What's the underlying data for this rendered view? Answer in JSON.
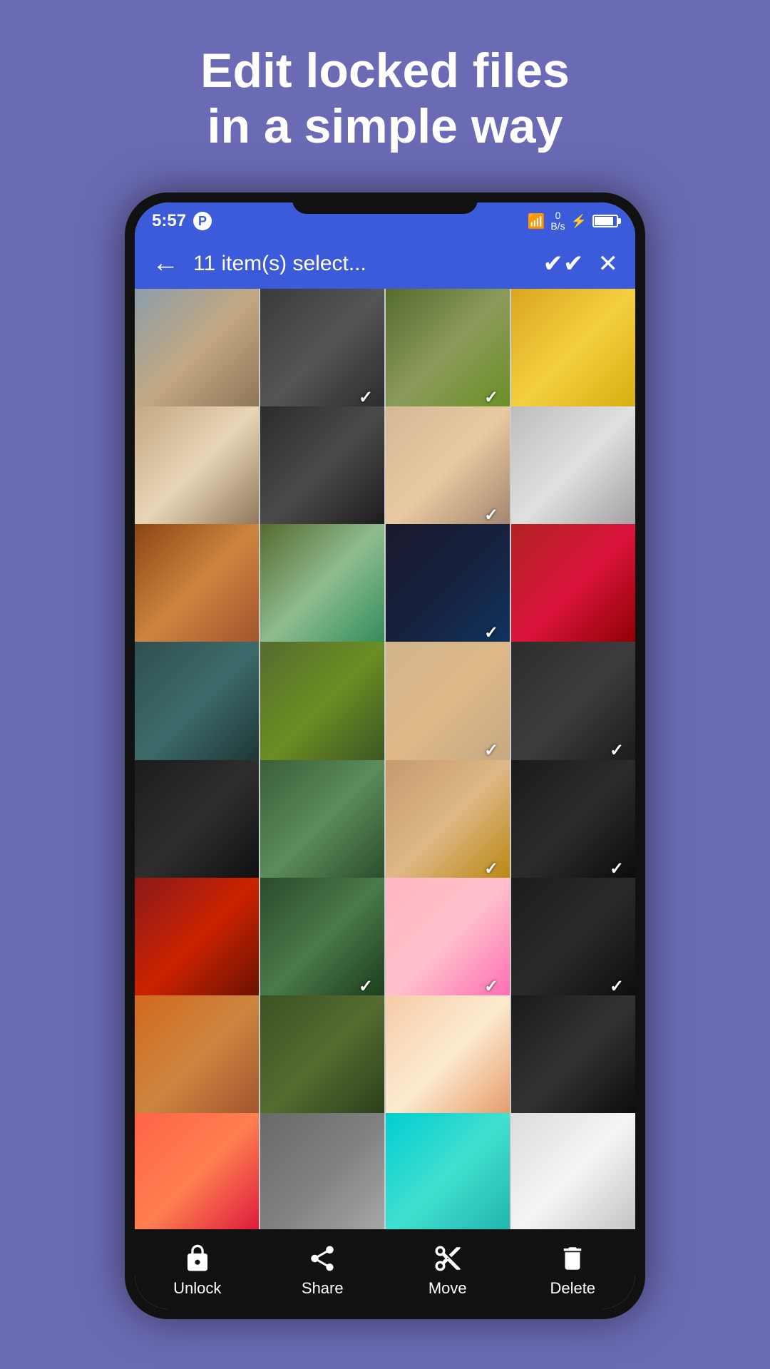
{
  "headline": {
    "line1": "Edit locked files",
    "line2": "in a simple way"
  },
  "status_bar": {
    "time": "5:57",
    "app_icon": "P",
    "wifi": "WiFi",
    "data": "0\nB/s",
    "battery_percent": 85
  },
  "toolbar": {
    "title": "11 item(s) select...",
    "back_label": "←",
    "select_all_label": "✔✔",
    "close_label": "✕"
  },
  "photos": [
    {
      "id": 1,
      "color_class": "c1",
      "selected": false
    },
    {
      "id": 2,
      "color_class": "c2",
      "selected": true
    },
    {
      "id": 3,
      "color_class": "c3",
      "selected": true
    },
    {
      "id": 4,
      "color_class": "c4",
      "selected": false
    },
    {
      "id": 5,
      "color_class": "c5",
      "selected": false
    },
    {
      "id": 6,
      "color_class": "c6",
      "selected": false
    },
    {
      "id": 7,
      "color_class": "c7",
      "selected": false
    },
    {
      "id": 8,
      "color_class": "c8",
      "selected": false
    },
    {
      "id": 9,
      "color_class": "c9",
      "selected": false
    },
    {
      "id": 10,
      "color_class": "c10",
      "selected": false
    },
    {
      "id": 11,
      "color_class": "c11",
      "selected": true
    },
    {
      "id": 12,
      "color_class": "c12",
      "selected": false
    },
    {
      "id": 13,
      "color_class": "c13",
      "selected": true
    },
    {
      "id": 14,
      "color_class": "c14",
      "selected": false
    },
    {
      "id": 15,
      "color_class": "c15",
      "selected": true
    },
    {
      "id": 16,
      "color_class": "c16",
      "selected": true
    },
    {
      "id": 17,
      "color_class": "c17",
      "selected": false
    },
    {
      "id": 18,
      "color_class": "c18",
      "selected": false
    },
    {
      "id": 19,
      "color_class": "c19",
      "selected": true
    },
    {
      "id": 20,
      "color_class": "c20",
      "selected": true
    },
    {
      "id": 21,
      "color_class": "c21",
      "selected": false
    },
    {
      "id": 22,
      "color_class": "c22",
      "selected": true
    },
    {
      "id": 23,
      "color_class": "c23",
      "selected": true
    },
    {
      "id": 24,
      "color_class": "c24",
      "selected": true
    },
    {
      "id": 25,
      "color_class": "c25",
      "selected": false
    },
    {
      "id": 26,
      "color_class": "c26",
      "selected": false
    },
    {
      "id": 27,
      "color_class": "c27",
      "selected": false
    },
    {
      "id": 28,
      "color_class": "c28",
      "selected": false
    },
    {
      "id": 29,
      "color_class": "c29",
      "selected": false
    },
    {
      "id": 30,
      "color_class": "c30",
      "selected": false
    },
    {
      "id": 31,
      "color_class": "c31",
      "selected": false
    },
    {
      "id": 32,
      "color_class": "c32",
      "selected": false
    }
  ],
  "bottom_actions": [
    {
      "id": "unlock",
      "label": "Unlock",
      "icon": "lock"
    },
    {
      "id": "share",
      "label": "Share",
      "icon": "share"
    },
    {
      "id": "move",
      "label": "Move",
      "icon": "scissors"
    },
    {
      "id": "delete",
      "label": "Delete",
      "icon": "trash"
    }
  ]
}
